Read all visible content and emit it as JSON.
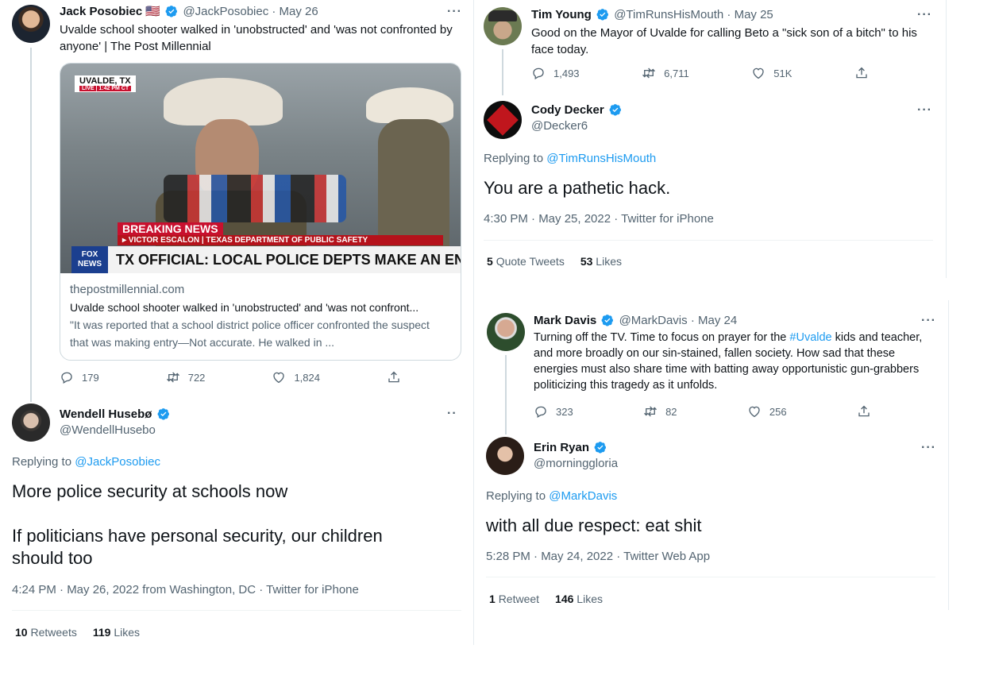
{
  "colors": {
    "accent": "#1d9bf0",
    "verified": "#1d9bf0",
    "muted": "#536471",
    "text": "#0f1419"
  },
  "left": {
    "parent": {
      "name": "Jack Posobiec",
      "flag": "🇺🇸",
      "handle": "@JackPosobiec",
      "date": "· May 26",
      "more": "···",
      "text": "Uvalde school shooter walked in 'unobstructed' and 'was not confronted by anyone' | The Post Millennial",
      "card": {
        "location": "UVALDE, TX",
        "live": "LIVE | 1:42 PM CT",
        "breaking": "BREAKING NEWS",
        "nameplate": "▸ VICTOR ESCALON | TEXAS DEPARTMENT OF PUBLIC SAFETY",
        "headline": "TX OFFICIAL: LOCAL POLICE DEPTS MAKE AN ENTRY",
        "logo": "FOX NEWS",
        "domain": "thepostmillennial.com",
        "title": "Uvalde school shooter walked in 'unobstructed' and 'was not confront...",
        "desc": "\"It was reported that a school district police officer confronted the suspect that was making entry—Not accurate. He walked in ..."
      },
      "replies": "179",
      "retweets": "722",
      "likes": "1,824"
    },
    "reply": {
      "name": "Wendell Husebø",
      "handle": "@WendellHusebo",
      "more": "··",
      "replying_prefix": "Replying to ",
      "replying_to": "@JackPosobiec",
      "text1": "More police security at schools now",
      "text2": "If politicians have personal security, our children should too",
      "meta": "4:24 PM · May 26, 2022 from Washington, DC · Twitter for iPhone",
      "retweets_count": "10",
      "retweets_label": "Retweets",
      "likes_count": "119",
      "likes_label": "Likes"
    }
  },
  "right_top": {
    "parent": {
      "name": "Tim Young",
      "handle": "@TimRunsHisMouth",
      "date": "· May 25",
      "more": "···",
      "text": "Good on the Mayor of Uvalde for calling Beto a \"sick son of a bitch\" to his face today.",
      "replies": "1,493",
      "retweets": "6,711",
      "likes": "51K"
    },
    "reply": {
      "name": "Cody Decker",
      "handle": "@Decker6",
      "more": "···",
      "replying_prefix": "Replying to ",
      "replying_to": "@TimRunsHisMouth",
      "text": "You are a pathetic hack.",
      "meta": "4:30 PM · May 25, 2022 · Twitter for iPhone",
      "quotes_count": "5",
      "quotes_label": "Quote Tweets",
      "likes_count": "53",
      "likes_label": "Likes"
    }
  },
  "right_bottom": {
    "parent": {
      "name": "Mark Davis",
      "handle": "@MarkDavis",
      "date": "· May 24",
      "more": "···",
      "text_a": "Turning off the TV. Time to focus on prayer for the ",
      "hashtag": "#Uvalde",
      "text_b": " kids and teacher, and more broadly on our sin-stained, fallen society. How sad that these energies must also share time with batting away opportunistic gun-grabbers politicizing this tragedy as it unfolds.",
      "replies": "323",
      "retweets": "82",
      "likes": "256"
    },
    "reply": {
      "name": "Erin Ryan",
      "handle": "@morninggloria",
      "more": "···",
      "replying_prefix": "Replying to ",
      "replying_to": "@MarkDavis",
      "text": "with all due respect: eat shit",
      "meta": "5:28 PM · May 24, 2022 · Twitter Web App",
      "retweets_count": "1",
      "retweets_label": "Retweet",
      "likes_count": "146",
      "likes_label": "Likes"
    }
  }
}
